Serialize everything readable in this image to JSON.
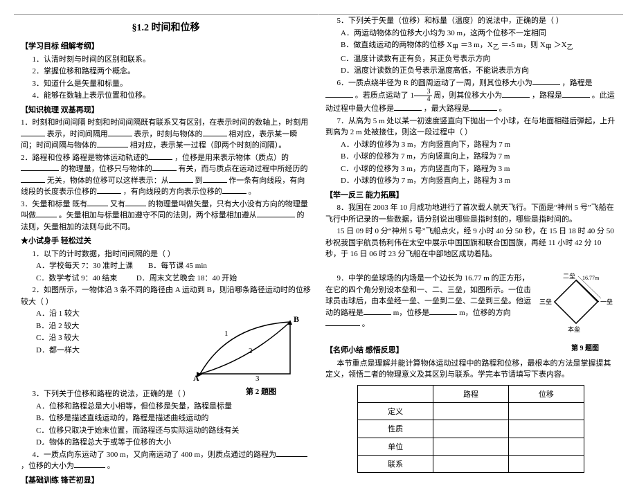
{
  "title": "§1.2 时间和位移",
  "goals_head": "【学习目标   细解考纲】",
  "goals": [
    "1．认清时刻与时间的区别和联系。",
    "2．掌握位移和路程两个概念。",
    "3．知道什么是矢量和标量。",
    "4．能够在数轴上表示位置和位移。"
  ],
  "knowledge_head": "【知识梳理   双基再现】",
  "k1_a": "1．时刻和时间间隔    时刻和时间间隔既有联系又有区别，在表示时间的数轴上，时刻用",
  "k1_b": "表示，时间间隔用",
  "k1_c": "表示，时刻与物体的",
  "k1_d": "相对应，表示某一瞬间；时间间隔与物体的",
  "k1_e": "相对应，表示某一过程（即两个时刻的间隔）。",
  "k2_a": "2．路程和位移    路程是物体运动轨迹的",
  "k2_b": "，位移是用来表示物体（质点）的",
  "k2_c": "的物理量，位移只与物体的",
  "k2_d": "有关，而与质点在运动过程中所经历的",
  "k2_e": "无关，物体的位移可以这样表示：从",
  "k2_f": "到",
  "k2_g": "作一条有向线段，有向线段的长度表示位移的",
  "k2_h": "，有向线段的方向表示位移的",
  "k2_i": "。",
  "k3_a": "3．矢量和标量    既有",
  "k3_b": "又有",
  "k3_c": "的物理量叫做矢量，只有大小没有方向的物理量叫做",
  "k3_d": "。矢量相加与标量相加遵守不同的法则，两个标量相加遵从",
  "k3_e": "的法则，矢量相加的法则与此不同。",
  "try_head": "★小试身手  轻松过关",
  "t1": "1．以下的计时数据，指时间间隔的是（    ）",
  "t1a": "A．学校每天 7：30 准时上课",
  "t1b": "B．每节课 45 min",
  "t1c": "C．数学考试 9：40 结束",
  "t1d": "D．周末文艺晚会 18：40 开始",
  "t2": "2．如图所示，一物体沿 3 条不同的路径由 A 运动到 B，则沿哪条路径运动时的位移较大（    ）",
  "t2a": "A．沿 1 较大",
  "t2b": "B．沿 2 较大",
  "t2c": "C．沿 3 较大",
  "t2d": "D．都一样大",
  "fig2_label": "第 2 题图",
  "t3": "3．下列关于位移和路程的说法，正确的是（    ）",
  "t3a": "A．位移和路程总是大小相等，但位移是矢量，路程是标量",
  "t3b": "B．位移是描述直线运动的，路程是描述曲线运动的",
  "t3c": "C．位移只取决于始末位置，而路程还与实际运动的路线有关",
  "t3d": "D．物体的路程总大于或等于位移的大小",
  "t4_a": "4．一质点向东运动了 300 m，又向南运动了 400 m，则质点通过的路程为",
  "t4_b": "，位移的大小为",
  "t4_c": "。",
  "base_head": "【基础训练   锋芒初显】",
  "r5": "5．下列关于矢量（位移）和标量（温度）的说法中，正确的是（    ）",
  "r5a": "A．两运动物体的位移大小均为 30 m，这两个位移不一定相同",
  "r5b_a": "B．做直线运动的两物体的位移 X",
  "r5b_b": "＝3 m，X",
  "r5b_c": "＝-5 m，则 X",
  "r5b_d": "＞X",
  "r5c": "C．温度计读数有正有负，其正负号表示方向",
  "r5d": "D．温度计读数的正负号表示温度高低，不能说表示方向",
  "r6_a": "6．一质点绕半径为 R 的圆周运动了一周，则其位移大小为",
  "r6_b": "，路程是",
  "r6_c": "。若质点运动了 1",
  "r6_d": "周，则其位移大小为",
  "r6_e": "，路程是",
  "r6_f": "。此运动过程中最大位移是",
  "r6_g": "，最大路程是",
  "r6_h": "。",
  "r7_a": "7．从高为 5 m 处以某一初速度竖直向下抛出一个小球，在与地面相碰后弹起，上升到高为 2 m 处被接住，则这一段过程中（    ）",
  "r7a": "A．小球的位移为 3 m，方向竖直向下，路程为 7 m",
  "r7b": "B．小球的位移为 7 m，方向竖直向上，路程为 7 m",
  "r7c": "C．小球的位移为 3 m，方向竖直向下，路程为 3 m",
  "r7d": "D．小球的位移为 7 m，方向竖直向上，路程为 3 m",
  "ext_head": "【举一反三   能力拓展】",
  "r8_a": "8．我国在 2003 年 10 月成功地进行了首次载人航天飞行。下面是“神州 5 号”飞船在飞行中所记录的一些数据，请分别说出哪些是指时刻的，哪些是指时间的。",
  "r8_b": "15 日 09 时 0 分“神州 5 号”飞船点火，经 9 小时 40 分 50 秒，在 15 日 18 时 40 分 50 秒祝我国宇航员杨利伟在太空中展示中国国旗和联合国国旗，再经 11 小时 42 分 10 秒，于 16 日 06 时 23 分飞船在中部地区成功着陆。",
  "r9_a": "9．中学的垒球场的内场是一个边长为 16.77 m 的正方形，在它的四个角分别设本垒和一、二、三垒，如图所示。一位击球员击球后，由本垒经一垒、一垒到二垒、二垒到三垒。他运动的路程是",
  "r9_b": " m，位移是",
  "r9_c": " m，位移的方向",
  "r9_d": "。",
  "fig9_top": "16.77m",
  "fig9_2": "二垒",
  "fig9_3": "三垒",
  "fig9_1": "一垒",
  "fig9_home": "本垒",
  "fig9_label": "第 9 题图",
  "summary_head": "【名师小结   感悟反思】",
  "summary_body": "本节重点是理解并能计算物体运动过程中的路程和位移，最根本的方法是掌握提其定义，领悟二者的物理意义及其区别与联系。学完本节请填写下表内容。",
  "th_path": "路程",
  "th_disp": "位移",
  "row_def": "定义",
  "row_nature": "性质",
  "row_unit": "单位",
  "row_rel": "联系",
  "frac_n": "3",
  "frac_d": "4",
  "sub_jia": "甲",
  "sub_yi": "乙",
  "fig2_A": "A",
  "fig2_B": "B",
  "fig2_1": "1",
  "fig2_2": "2",
  "fig2_3": "3"
}
